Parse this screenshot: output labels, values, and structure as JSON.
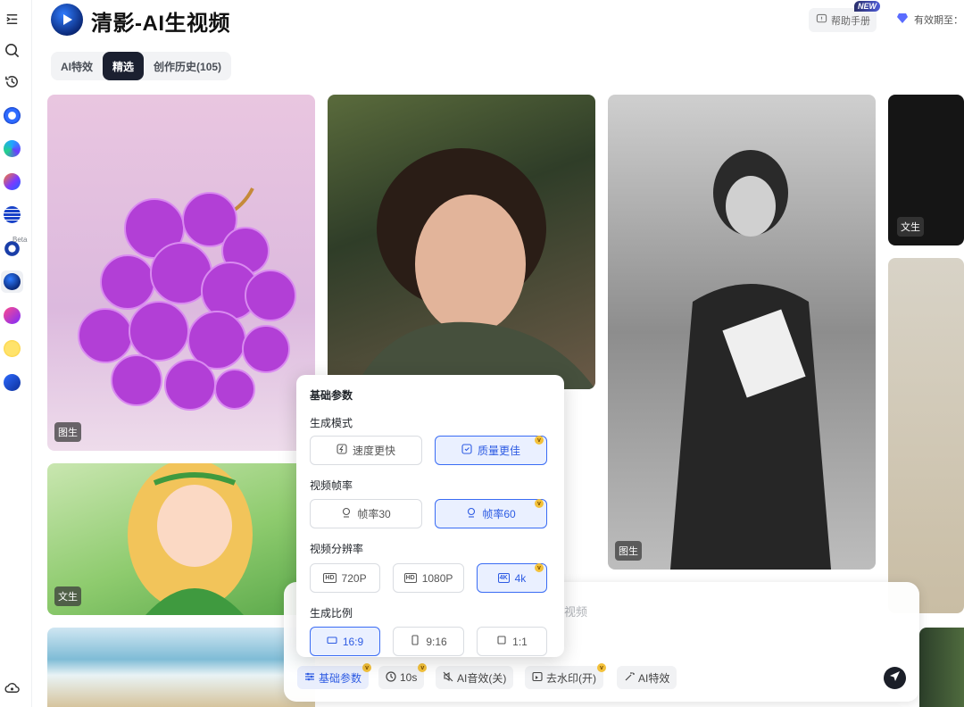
{
  "app": {
    "title": "清影-AI生视频",
    "help_label": "帮助手册",
    "new_badge": "NEW",
    "validity_label": "有效期至："
  },
  "rail": {
    "beta_label": "Beta",
    "items": [
      "expand-icon",
      "search-icon",
      "history-icon",
      "app-blue-ring-icon",
      "app-search-q-icon",
      "app-gradient-icon",
      "app-list-icon",
      "app-ring-icon",
      "qingying-icon",
      "app-p-icon",
      "app-face-icon",
      "app-chart-icon",
      "cloud-icon"
    ]
  },
  "tabs": [
    {
      "label": "AI特效",
      "selected": false
    },
    {
      "label": "精选",
      "selected": true
    },
    {
      "label": "创作历史(105)",
      "selected": false
    }
  ],
  "gallery": [
    {
      "tag": "图生",
      "subject": "purple glass grapes"
    },
    {
      "tag": "",
      "subject": "woman portrait"
    },
    {
      "tag": "图生",
      "subject": "black and white woman walking"
    },
    {
      "tag": "文生",
      "subject": "dark scene"
    },
    {
      "tag": "文生",
      "subject": "cartoon girl with butterflies"
    },
    {
      "tag": "",
      "subject": "sand texture"
    },
    {
      "tag": "",
      "subject": "beach waves"
    },
    {
      "tag": "",
      "subject": "bookshelf"
    }
  ],
  "params": {
    "header": "基础参数",
    "mode": {
      "label": "生成模式",
      "options": [
        {
          "label": "速度更快",
          "selected": false
        },
        {
          "label": "质量更佳",
          "selected": true,
          "vip": true
        }
      ]
    },
    "fps": {
      "label": "视频帧率",
      "options": [
        {
          "label": "帧率30",
          "selected": false
        },
        {
          "label": "帧率60",
          "selected": true,
          "vip": true
        }
      ]
    },
    "resolution": {
      "label": "视频分辨率",
      "options": [
        {
          "label": "720P",
          "selected": false
        },
        {
          "label": "1080P",
          "selected": false
        },
        {
          "label": "4k",
          "selected": true,
          "vip": true
        }
      ]
    },
    "ratio": {
      "label": "生成比例",
      "options": [
        {
          "label": "16:9",
          "selected": true
        },
        {
          "label": "9:16",
          "selected": false
        },
        {
          "label": "1:1",
          "selected": false
        }
      ]
    }
  },
  "prompt": {
    "placeholder_visible": "视频",
    "chips": [
      {
        "label": "基础参数",
        "active": true,
        "vip": true
      },
      {
        "label": "10s",
        "active": false,
        "vip": true
      },
      {
        "label": "AI音效(关)",
        "active": false,
        "vip": false
      },
      {
        "label": "去水印(开)",
        "active": false,
        "vip": true
      },
      {
        "label": "AI特效",
        "active": false,
        "vip": false
      }
    ],
    "vip_mark": "v"
  },
  "colors": {
    "accent": "#2d5be3",
    "dark": "#1b2030",
    "vip": "#f3c13a"
  }
}
